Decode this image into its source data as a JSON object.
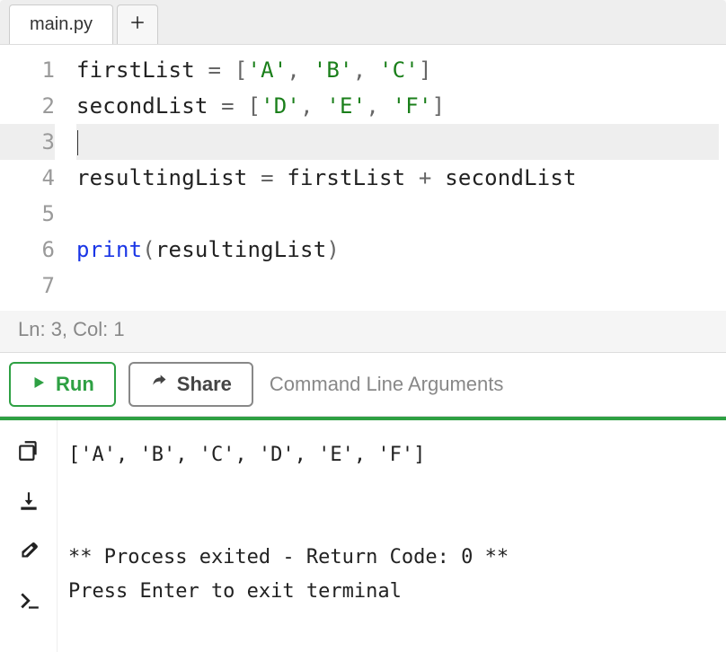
{
  "tabs": {
    "active": "main.py"
  },
  "editor": {
    "lines": [
      {
        "n": 1,
        "tokens": [
          [
            "plain",
            "firstList "
          ],
          [
            "op",
            "="
          ],
          [
            "plain",
            " "
          ],
          [
            "punc",
            "["
          ],
          [
            "str",
            "'A'"
          ],
          [
            "punc",
            ","
          ],
          [
            "plain",
            " "
          ],
          [
            "str",
            "'B'"
          ],
          [
            "punc",
            ","
          ],
          [
            "plain",
            " "
          ],
          [
            "str",
            "'C'"
          ],
          [
            "punc",
            "]"
          ]
        ]
      },
      {
        "n": 2,
        "tokens": [
          [
            "plain",
            "secondList "
          ],
          [
            "op",
            "="
          ],
          [
            "plain",
            " "
          ],
          [
            "punc",
            "["
          ],
          [
            "str",
            "'D'"
          ],
          [
            "punc",
            ","
          ],
          [
            "plain",
            " "
          ],
          [
            "str",
            "'E'"
          ],
          [
            "punc",
            ","
          ],
          [
            "plain",
            " "
          ],
          [
            "str",
            "'F'"
          ],
          [
            "punc",
            "]"
          ]
        ]
      },
      {
        "n": 3,
        "tokens": [],
        "current": true
      },
      {
        "n": 4,
        "tokens": [
          [
            "plain",
            "resultingList "
          ],
          [
            "op",
            "="
          ],
          [
            "plain",
            " firstList "
          ],
          [
            "op",
            "+"
          ],
          [
            "plain",
            " secondList"
          ]
        ]
      },
      {
        "n": 5,
        "tokens": []
      },
      {
        "n": 6,
        "tokens": [
          [
            "builtin",
            "print"
          ],
          [
            "punc",
            "("
          ],
          [
            "plain",
            "resultingList"
          ],
          [
            "punc",
            ")"
          ]
        ]
      },
      {
        "n": 7,
        "tokens": []
      }
    ],
    "status": "Ln: 3,  Col: 1"
  },
  "toolbar": {
    "run_label": "Run",
    "share_label": "Share",
    "cli_placeholder": "Command Line Arguments"
  },
  "terminal": {
    "lines": [
      "['A', 'B', 'C', 'D', 'E', 'F']",
      "",
      "",
      "** Process exited - Return Code: 0 **",
      "Press Enter to exit terminal"
    ]
  }
}
